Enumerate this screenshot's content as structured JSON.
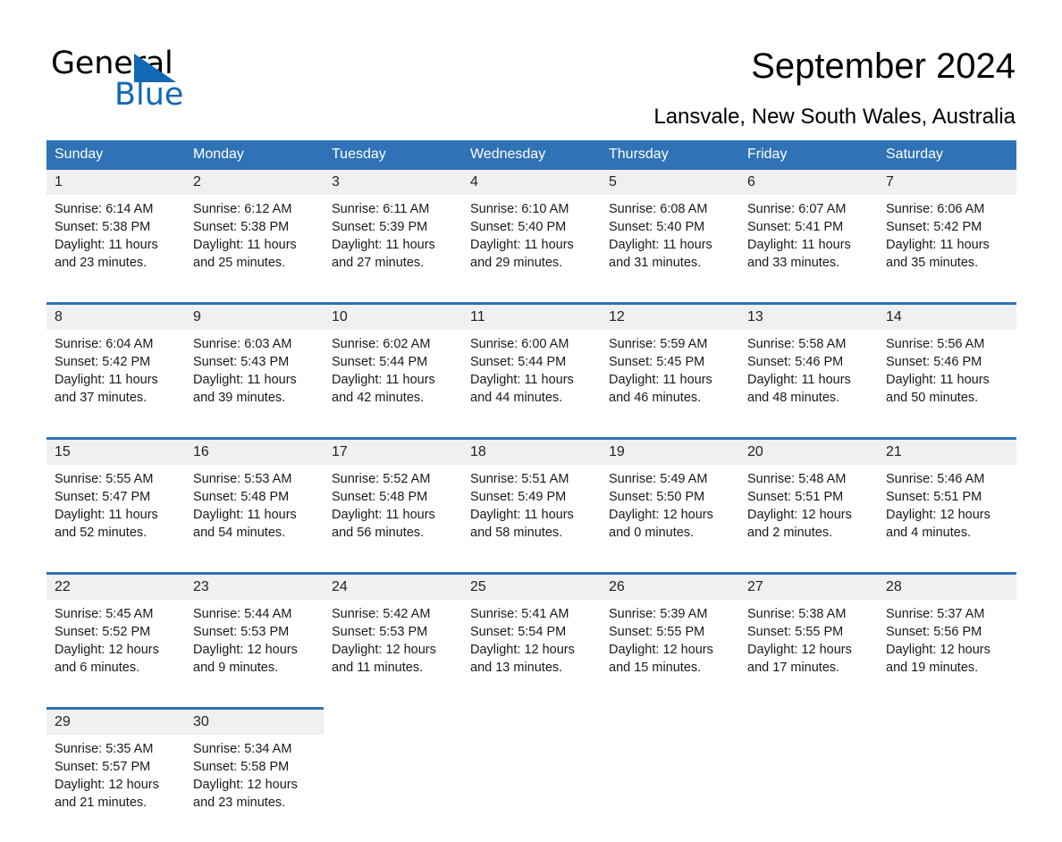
{
  "brand": {
    "name_part1": "General",
    "name_part2": "Blue",
    "accent_color": "#1268b3"
  },
  "header": {
    "title": "September 2024",
    "location": "Lansvale, New South Wales, Australia"
  },
  "theme": {
    "header_row_color": "#2f72b5",
    "daynum_row_color": "#f0f0f0",
    "page_background": "#ffffff"
  },
  "weekdays": [
    "Sunday",
    "Monday",
    "Tuesday",
    "Wednesday",
    "Thursday",
    "Friday",
    "Saturday"
  ],
  "weeks": [
    {
      "days": [
        {
          "day": "1",
          "sunrise": "Sunrise: 6:14 AM",
          "sunset": "Sunset: 5:38 PM",
          "daylight_line1": "Daylight: 11 hours",
          "daylight_line2": "and 23 minutes."
        },
        {
          "day": "2",
          "sunrise": "Sunrise: 6:12 AM",
          "sunset": "Sunset: 5:38 PM",
          "daylight_line1": "Daylight: 11 hours",
          "daylight_line2": "and 25 minutes."
        },
        {
          "day": "3",
          "sunrise": "Sunrise: 6:11 AM",
          "sunset": "Sunset: 5:39 PM",
          "daylight_line1": "Daylight: 11 hours",
          "daylight_line2": "and 27 minutes."
        },
        {
          "day": "4",
          "sunrise": "Sunrise: 6:10 AM",
          "sunset": "Sunset: 5:40 PM",
          "daylight_line1": "Daylight: 11 hours",
          "daylight_line2": "and 29 minutes."
        },
        {
          "day": "5",
          "sunrise": "Sunrise: 6:08 AM",
          "sunset": "Sunset: 5:40 PM",
          "daylight_line1": "Daylight: 11 hours",
          "daylight_line2": "and 31 minutes."
        },
        {
          "day": "6",
          "sunrise": "Sunrise: 6:07 AM",
          "sunset": "Sunset: 5:41 PM",
          "daylight_line1": "Daylight: 11 hours",
          "daylight_line2": "and 33 minutes."
        },
        {
          "day": "7",
          "sunrise": "Sunrise: 6:06 AM",
          "sunset": "Sunset: 5:42 PM",
          "daylight_line1": "Daylight: 11 hours",
          "daylight_line2": "and 35 minutes."
        }
      ]
    },
    {
      "days": [
        {
          "day": "8",
          "sunrise": "Sunrise: 6:04 AM",
          "sunset": "Sunset: 5:42 PM",
          "daylight_line1": "Daylight: 11 hours",
          "daylight_line2": "and 37 minutes."
        },
        {
          "day": "9",
          "sunrise": "Sunrise: 6:03 AM",
          "sunset": "Sunset: 5:43 PM",
          "daylight_line1": "Daylight: 11 hours",
          "daylight_line2": "and 39 minutes."
        },
        {
          "day": "10",
          "sunrise": "Sunrise: 6:02 AM",
          "sunset": "Sunset: 5:44 PM",
          "daylight_line1": "Daylight: 11 hours",
          "daylight_line2": "and 42 minutes."
        },
        {
          "day": "11",
          "sunrise": "Sunrise: 6:00 AM",
          "sunset": "Sunset: 5:44 PM",
          "daylight_line1": "Daylight: 11 hours",
          "daylight_line2": "and 44 minutes."
        },
        {
          "day": "12",
          "sunrise": "Sunrise: 5:59 AM",
          "sunset": "Sunset: 5:45 PM",
          "daylight_line1": "Daylight: 11 hours",
          "daylight_line2": "and 46 minutes."
        },
        {
          "day": "13",
          "sunrise": "Sunrise: 5:58 AM",
          "sunset": "Sunset: 5:46 PM",
          "daylight_line1": "Daylight: 11 hours",
          "daylight_line2": "and 48 minutes."
        },
        {
          "day": "14",
          "sunrise": "Sunrise: 5:56 AM",
          "sunset": "Sunset: 5:46 PM",
          "daylight_line1": "Daylight: 11 hours",
          "daylight_line2": "and 50 minutes."
        }
      ]
    },
    {
      "days": [
        {
          "day": "15",
          "sunrise": "Sunrise: 5:55 AM",
          "sunset": "Sunset: 5:47 PM",
          "daylight_line1": "Daylight: 11 hours",
          "daylight_line2": "and 52 minutes."
        },
        {
          "day": "16",
          "sunrise": "Sunrise: 5:53 AM",
          "sunset": "Sunset: 5:48 PM",
          "daylight_line1": "Daylight: 11 hours",
          "daylight_line2": "and 54 minutes."
        },
        {
          "day": "17",
          "sunrise": "Sunrise: 5:52 AM",
          "sunset": "Sunset: 5:48 PM",
          "daylight_line1": "Daylight: 11 hours",
          "daylight_line2": "and 56 minutes."
        },
        {
          "day": "18",
          "sunrise": "Sunrise: 5:51 AM",
          "sunset": "Sunset: 5:49 PM",
          "daylight_line1": "Daylight: 11 hours",
          "daylight_line2": "and 58 minutes."
        },
        {
          "day": "19",
          "sunrise": "Sunrise: 5:49 AM",
          "sunset": "Sunset: 5:50 PM",
          "daylight_line1": "Daylight: 12 hours",
          "daylight_line2": "and 0 minutes."
        },
        {
          "day": "20",
          "sunrise": "Sunrise: 5:48 AM",
          "sunset": "Sunset: 5:51 PM",
          "daylight_line1": "Daylight: 12 hours",
          "daylight_line2": "and 2 minutes."
        },
        {
          "day": "21",
          "sunrise": "Sunrise: 5:46 AM",
          "sunset": "Sunset: 5:51 PM",
          "daylight_line1": "Daylight: 12 hours",
          "daylight_line2": "and 4 minutes."
        }
      ]
    },
    {
      "days": [
        {
          "day": "22",
          "sunrise": "Sunrise: 5:45 AM",
          "sunset": "Sunset: 5:52 PM",
          "daylight_line1": "Daylight: 12 hours",
          "daylight_line2": "and 6 minutes."
        },
        {
          "day": "23",
          "sunrise": "Sunrise: 5:44 AM",
          "sunset": "Sunset: 5:53 PM",
          "daylight_line1": "Daylight: 12 hours",
          "daylight_line2": "and 9 minutes."
        },
        {
          "day": "24",
          "sunrise": "Sunrise: 5:42 AM",
          "sunset": "Sunset: 5:53 PM",
          "daylight_line1": "Daylight: 12 hours",
          "daylight_line2": "and 11 minutes."
        },
        {
          "day": "25",
          "sunrise": "Sunrise: 5:41 AM",
          "sunset": "Sunset: 5:54 PM",
          "daylight_line1": "Daylight: 12 hours",
          "daylight_line2": "and 13 minutes."
        },
        {
          "day": "26",
          "sunrise": "Sunrise: 5:39 AM",
          "sunset": "Sunset: 5:55 PM",
          "daylight_line1": "Daylight: 12 hours",
          "daylight_line2": "and 15 minutes."
        },
        {
          "day": "27",
          "sunrise": "Sunrise: 5:38 AM",
          "sunset": "Sunset: 5:55 PM",
          "daylight_line1": "Daylight: 12 hours",
          "daylight_line2": "and 17 minutes."
        },
        {
          "day": "28",
          "sunrise": "Sunrise: 5:37 AM",
          "sunset": "Sunset: 5:56 PM",
          "daylight_line1": "Daylight: 12 hours",
          "daylight_line2": "and 19 minutes."
        }
      ]
    },
    {
      "days": [
        {
          "day": "29",
          "sunrise": "Sunrise: 5:35 AM",
          "sunset": "Sunset: 5:57 PM",
          "daylight_line1": "Daylight: 12 hours",
          "daylight_line2": "and 21 minutes."
        },
        {
          "day": "30",
          "sunrise": "Sunrise: 5:34 AM",
          "sunset": "Sunset: 5:58 PM",
          "daylight_line1": "Daylight: 12 hours",
          "daylight_line2": "and 23 minutes."
        },
        {
          "day": "",
          "sunrise": "",
          "sunset": "",
          "daylight_line1": "",
          "daylight_line2": ""
        },
        {
          "day": "",
          "sunrise": "",
          "sunset": "",
          "daylight_line1": "",
          "daylight_line2": ""
        },
        {
          "day": "",
          "sunrise": "",
          "sunset": "",
          "daylight_line1": "",
          "daylight_line2": ""
        },
        {
          "day": "",
          "sunrise": "",
          "sunset": "",
          "daylight_line1": "",
          "daylight_line2": ""
        },
        {
          "day": "",
          "sunrise": "",
          "sunset": "",
          "daylight_line1": "",
          "daylight_line2": ""
        }
      ]
    }
  ]
}
